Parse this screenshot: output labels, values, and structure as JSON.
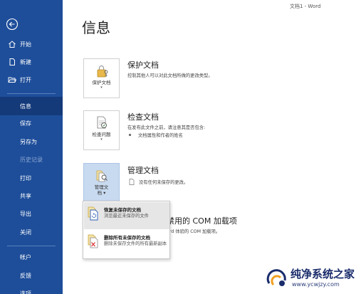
{
  "window": {
    "doc_title": "文档1 - Word"
  },
  "main": {
    "page_title": "信息"
  },
  "sidebar": {
    "items": [
      {
        "label": "开始"
      },
      {
        "label": "新建"
      },
      {
        "label": "打开"
      },
      {
        "label": "信息"
      },
      {
        "label": "保存"
      },
      {
        "label": "另存为"
      },
      {
        "label": "历史记录"
      },
      {
        "label": "打印"
      },
      {
        "label": "共享"
      },
      {
        "label": "导出"
      },
      {
        "label": "关闭"
      },
      {
        "label": "帐户"
      },
      {
        "label": "反馈"
      },
      {
        "label": "选项"
      }
    ]
  },
  "sections": {
    "protect": {
      "title": "保护文档",
      "desc": "控制其他人可以对此文档所做的更改类型。",
      "tile_label": "保护文档",
      "tile_caret": "▾"
    },
    "inspect": {
      "title": "检查文档",
      "desc": "在发布此文件之前，请注意其是否包含:",
      "bullet": "文档属性和作者的姓名",
      "tile_label": "检查问题",
      "tile_caret": "▾"
    },
    "manage": {
      "title": "管理文档",
      "desc": "没有任何未保存的更改。",
      "tile_label": "管理文",
      "tile_label2": "档 ▾"
    },
    "com": {
      "title": "禁用的 COM 加载项",
      "desc": "ord 体验的 COM 加载项。"
    }
  },
  "dropdown": {
    "items": [
      {
        "title": "恢复未保存的文档",
        "desc": "浏览最近未保存的文件"
      },
      {
        "title": "删除所有未保存的文档",
        "desc": "删除未保存文件的所有最新副本"
      }
    ]
  },
  "watermark": {
    "main": "纯净系统之家",
    "url": "www.ycwjzy.com"
  },
  "colors": {
    "sidebar": "#1e4e9a",
    "sidebar_active": "#143a7a",
    "tile_selected": "#c8daf0"
  }
}
